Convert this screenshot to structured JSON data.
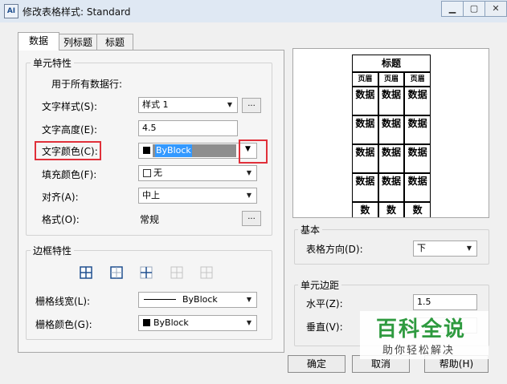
{
  "window": {
    "title": "修改表格样式: Standard",
    "app_icon_text": "AI"
  },
  "tabs": [
    {
      "label": "数据"
    },
    {
      "label": "列标题"
    },
    {
      "label": "标题"
    }
  ],
  "cell_props": {
    "group_label": "单元特性",
    "apply_all": "用于所有数据行:",
    "text_style_label": "文字样式(S):",
    "text_style_value": "样式 1",
    "text_height_label": "文字高度(E):",
    "text_height_value": "4.5",
    "text_color_label": "文字颜色(C):",
    "text_color_value": "ByBlock",
    "fill_color_label": "填充颜色(F):",
    "fill_color_value": "无",
    "align_label": "对齐(A):",
    "align_value": "中上",
    "format_label": "格式(O):",
    "format_value": "常规",
    "ellipsis": "..."
  },
  "border_props": {
    "group_label": "边框特性",
    "line_width_label": "栅格线宽(L):",
    "line_width_value": "ByBlock",
    "grid_color_label": "栅格颜色(G):",
    "grid_color_value": "ByBlock"
  },
  "preview": {
    "title": "标题",
    "header_cell": "页眉",
    "data_cell": "数据",
    "cut_cell": "数"
  },
  "basic": {
    "group_label": "基本",
    "direction_label": "表格方向(D):",
    "direction_value": "下"
  },
  "margins": {
    "group_label": "单元边距",
    "horizontal_label": "水平(Z):",
    "horizontal_value": "1.5",
    "vertical_label": "垂直(V):"
  },
  "buttons": {
    "ok": "确定",
    "cancel": "取消",
    "help": "帮助(H)"
  },
  "watermark": {
    "line1": "百科全说",
    "line2": "助你轻松解决"
  },
  "colors": {
    "highlight_red": "#e0303a",
    "selection_blue": "#3399ff"
  }
}
